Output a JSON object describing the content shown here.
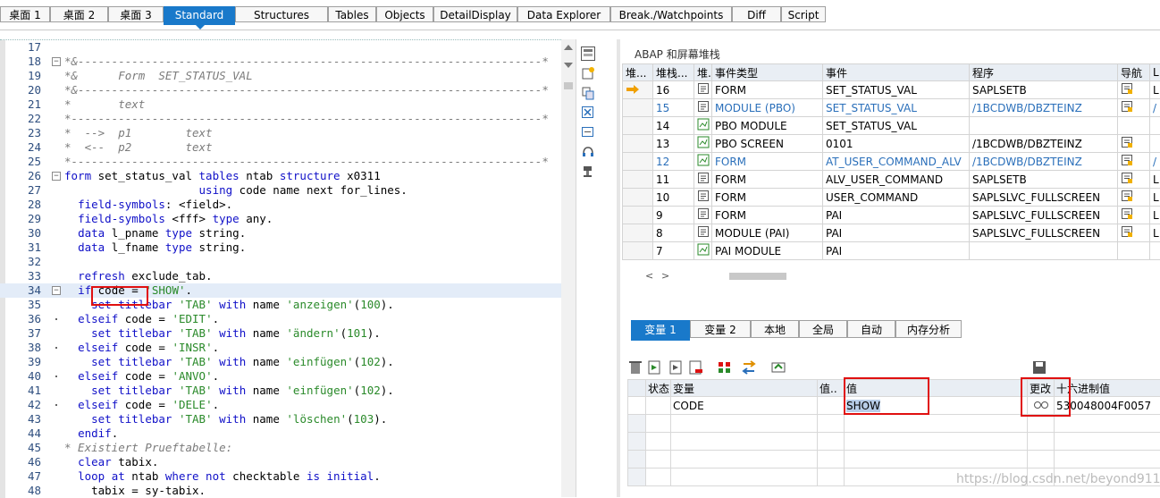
{
  "top_tabs": [
    {
      "label": "桌面 1"
    },
    {
      "label": "桌面 2"
    },
    {
      "label": "桌面 3"
    },
    {
      "label": "Standard"
    },
    {
      "label": "Structures"
    },
    {
      "label": "Tables"
    },
    {
      "label": "Objects"
    },
    {
      "label": "DetailDisplay"
    },
    {
      "label": "Data Explorer"
    },
    {
      "label": "Break./Watchpoints"
    },
    {
      "label": "Diff"
    },
    {
      "label": "Script"
    }
  ],
  "editor": {
    "line_numbers": [
      "17",
      "18",
      "19",
      "20",
      "21",
      "22",
      "23",
      "24",
      "25",
      "26",
      "27",
      "28",
      "29",
      "30",
      "31",
      "32",
      "33",
      "34",
      "35",
      "36",
      "37",
      "38",
      "39",
      "40",
      "41",
      "42",
      "43",
      "44",
      "45",
      "46",
      "47",
      "48"
    ],
    "lines": [
      [],
      [
        [
          "c-cm",
          "*&---------------------------------------------------------------------*"
        ]
      ],
      [
        [
          "c-cm",
          "*&      Form  SET_STATUS_VAL"
        ]
      ],
      [
        [
          "c-cm",
          "*&---------------------------------------------------------------------*"
        ]
      ],
      [
        [
          "c-cm",
          "*       text"
        ]
      ],
      [
        [
          "c-cm",
          "*----------------------------------------------------------------------*"
        ]
      ],
      [
        [
          "c-cm",
          "*  -->  p1        text"
        ]
      ],
      [
        [
          "c-cm",
          "*  <--  p2        text"
        ]
      ],
      [
        [
          "c-cm",
          "*----------------------------------------------------------------------*"
        ]
      ],
      [
        [
          "c-kw",
          "form"
        ],
        [
          "c-id",
          " set_status_val "
        ],
        [
          "c-kw",
          "tables"
        ],
        [
          "c-id",
          " ntab "
        ],
        [
          "c-kw",
          "structure"
        ],
        [
          "c-id",
          " x0311"
        ]
      ],
      [
        [
          "c-id",
          "                    "
        ],
        [
          "c-kw",
          "using"
        ],
        [
          "c-id",
          " code name next for_lines."
        ]
      ],
      [
        [
          "c-id",
          "  "
        ],
        [
          "c-kw",
          "field-symbols"
        ],
        [
          "c-id",
          ": <field>."
        ]
      ],
      [
        [
          "c-id",
          "  "
        ],
        [
          "c-kw",
          "field-symbols"
        ],
        [
          "c-id",
          " <fff> "
        ],
        [
          "c-kw",
          "type"
        ],
        [
          "c-id",
          " any."
        ]
      ],
      [
        [
          "c-id",
          "  "
        ],
        [
          "c-kw",
          "data"
        ],
        [
          "c-id",
          " l_pname "
        ],
        [
          "c-kw",
          "type"
        ],
        [
          "c-id",
          " string."
        ]
      ],
      [
        [
          "c-id",
          "  "
        ],
        [
          "c-kw",
          "data"
        ],
        [
          "c-id",
          " l_fname "
        ],
        [
          "c-kw",
          "type"
        ],
        [
          "c-id",
          " string."
        ]
      ],
      [],
      [
        [
          "c-id",
          "  "
        ],
        [
          "c-kw",
          "refresh"
        ],
        [
          "c-id",
          " exclude_tab."
        ]
      ],
      [
        [
          "c-id",
          "  "
        ],
        [
          "c-kw",
          "if"
        ],
        [
          "c-id",
          " code = "
        ],
        [
          "c-str",
          "'SHOW'"
        ],
        [
          "c-id",
          "."
        ]
      ],
      [
        [
          "c-id",
          "    "
        ],
        [
          "c-kw",
          "set titlebar"
        ],
        [
          "c-id",
          " "
        ],
        [
          "c-str",
          "'TAB'"
        ],
        [
          "c-id",
          " "
        ],
        [
          "c-kw",
          "with"
        ],
        [
          "c-id",
          " name "
        ],
        [
          "c-str",
          "'anzeigen'"
        ],
        [
          "c-id",
          "("
        ],
        [
          "c-num",
          "100"
        ],
        [
          "c-id",
          ")."
        ]
      ],
      [
        [
          "c-id",
          "  "
        ],
        [
          "c-kw",
          "elseif"
        ],
        [
          "c-id",
          " code = "
        ],
        [
          "c-str",
          "'EDIT'"
        ],
        [
          "c-id",
          "."
        ]
      ],
      [
        [
          "c-id",
          "    "
        ],
        [
          "c-kw",
          "set titlebar"
        ],
        [
          "c-id",
          " "
        ],
        [
          "c-str",
          "'TAB'"
        ],
        [
          "c-id",
          " "
        ],
        [
          "c-kw",
          "with"
        ],
        [
          "c-id",
          " name "
        ],
        [
          "c-str",
          "'ändern'"
        ],
        [
          "c-id",
          "("
        ],
        [
          "c-num",
          "101"
        ],
        [
          "c-id",
          ")."
        ]
      ],
      [
        [
          "c-id",
          "  "
        ],
        [
          "c-kw",
          "elseif"
        ],
        [
          "c-id",
          " code = "
        ],
        [
          "c-str",
          "'INSR'"
        ],
        [
          "c-id",
          "."
        ]
      ],
      [
        [
          "c-id",
          "    "
        ],
        [
          "c-kw",
          "set titlebar"
        ],
        [
          "c-id",
          " "
        ],
        [
          "c-str",
          "'TAB'"
        ],
        [
          "c-id",
          " "
        ],
        [
          "c-kw",
          "with"
        ],
        [
          "c-id",
          " name "
        ],
        [
          "c-str",
          "'einfügen'"
        ],
        [
          "c-id",
          "("
        ],
        [
          "c-num",
          "102"
        ],
        [
          "c-id",
          ")."
        ]
      ],
      [
        [
          "c-id",
          "  "
        ],
        [
          "c-kw",
          "elseif"
        ],
        [
          "c-id",
          " code = "
        ],
        [
          "c-str",
          "'ANVO'"
        ],
        [
          "c-id",
          "."
        ]
      ],
      [
        [
          "c-id",
          "    "
        ],
        [
          "c-kw",
          "set titlebar"
        ],
        [
          "c-id",
          " "
        ],
        [
          "c-str",
          "'TAB'"
        ],
        [
          "c-id",
          " "
        ],
        [
          "c-kw",
          "with"
        ],
        [
          "c-id",
          " name "
        ],
        [
          "c-str",
          "'einfügen'"
        ],
        [
          "c-id",
          "("
        ],
        [
          "c-num",
          "102"
        ],
        [
          "c-id",
          ")."
        ]
      ],
      [
        [
          "c-id",
          "  "
        ],
        [
          "c-kw",
          "elseif"
        ],
        [
          "c-id",
          " code = "
        ],
        [
          "c-str",
          "'DELE'"
        ],
        [
          "c-id",
          "."
        ]
      ],
      [
        [
          "c-id",
          "    "
        ],
        [
          "c-kw",
          "set titlebar"
        ],
        [
          "c-id",
          " "
        ],
        [
          "c-str",
          "'TAB'"
        ],
        [
          "c-id",
          " "
        ],
        [
          "c-kw",
          "with"
        ],
        [
          "c-id",
          " name "
        ],
        [
          "c-str",
          "'löschen'"
        ],
        [
          "c-id",
          "("
        ],
        [
          "c-num",
          "103"
        ],
        [
          "c-id",
          ")."
        ]
      ],
      [
        [
          "c-id",
          "  "
        ],
        [
          "c-kw",
          "endif"
        ],
        [
          "c-id",
          "."
        ]
      ],
      [
        [
          "c-cm",
          "* Existiert Prueftabelle:"
        ]
      ],
      [
        [
          "c-id",
          "  "
        ],
        [
          "c-kw",
          "clear"
        ],
        [
          "c-id",
          " tabix."
        ]
      ],
      [
        [
          "c-id",
          "  "
        ],
        [
          "c-kw",
          "loop at"
        ],
        [
          "c-id",
          " ntab "
        ],
        [
          "c-kw",
          "where not"
        ],
        [
          "c-id",
          " checktable "
        ],
        [
          "c-kw",
          "is initial"
        ],
        [
          "c-id",
          "."
        ]
      ],
      [
        [
          "c-id",
          "    tabix = sy-tabix."
        ]
      ]
    ]
  },
  "stack": {
    "title": "ABAP 和屏幕堆栈",
    "headers": [
      "堆...",
      "堆栈...",
      "堆.",
      "事件类型",
      "事件",
      "程序",
      "导航",
      "L"
    ],
    "rows": [
      {
        "level": "16",
        "type": "FORM",
        "event": "SET_STATUS_VAL",
        "program": "SAPLSETB",
        "nav": true,
        "extra": "L"
      },
      {
        "level": "15",
        "type": "MODULE (PBO)",
        "event": "SET_STATUS_VAL",
        "program": "/1BCDWB/DBZTEINZ",
        "nav": true,
        "extra": "/"
      },
      {
        "level": "14",
        "type": "PBO MODULE",
        "event": "SET_STATUS_VAL",
        "program": "",
        "nav": false,
        "extra": ""
      },
      {
        "level": "13",
        "type": "PBO SCREEN",
        "event": "0101",
        "program": "/1BCDWB/DBZTEINZ",
        "nav": true,
        "extra": ""
      },
      {
        "level": "12",
        "type": "FORM",
        "event": "AT_USER_COMMAND_ALV",
        "program": "/1BCDWB/DBZTEINZ",
        "nav": true,
        "extra": "/"
      },
      {
        "level": "11",
        "type": "FORM",
        "event": "ALV_USER_COMMAND",
        "program": "SAPLSETB",
        "nav": true,
        "extra": "L"
      },
      {
        "level": "10",
        "type": "FORM",
        "event": "USER_COMMAND",
        "program": "SAPLSLVC_FULLSCREEN",
        "nav": true,
        "extra": "L"
      },
      {
        "level": "9",
        "type": "FORM",
        "event": "PAI",
        "program": "SAPLSLVC_FULLSCREEN",
        "nav": true,
        "extra": "L"
      },
      {
        "level": "8",
        "type": "MODULE (PAI)",
        "event": "PAI",
        "program": "SAPLSLVC_FULLSCREEN",
        "nav": true,
        "extra": "L"
      },
      {
        "level": "7",
        "type": "PAI MODULE",
        "event": "PAI",
        "program": "",
        "nav": false,
        "extra": ""
      }
    ]
  },
  "var_tabs": [
    {
      "label": "变量 1"
    },
    {
      "label": "变量 2"
    },
    {
      "label": "本地"
    },
    {
      "label": "全局"
    },
    {
      "label": "自动"
    },
    {
      "label": "内存分析"
    }
  ],
  "var_table": {
    "headers": [
      "状态",
      "变量",
      "值..",
      "值",
      "更改",
      "十六进制值"
    ],
    "row": {
      "status": "",
      "variable": "CODE",
      "value_type": "",
      "value": "SHOW",
      "hex": "530048004F0057"
    }
  },
  "watermark": "https://blog.csdn.net/beyond911"
}
